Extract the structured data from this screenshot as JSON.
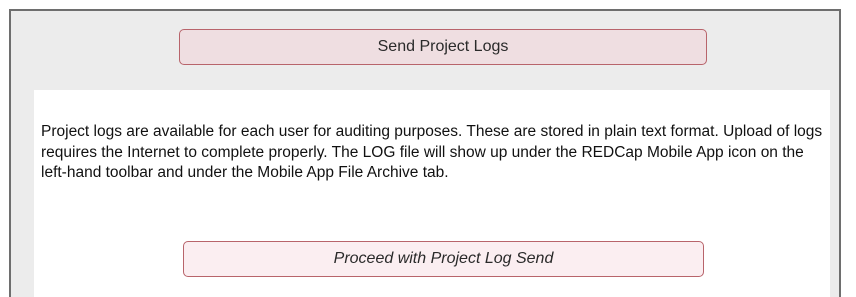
{
  "header": {
    "send_button_label": "Send Project Logs"
  },
  "panel": {
    "description": "Project logs are available for each user for auditing purposes. These are stored in plain text format. Upload of logs requires the Internet to complete properly. The LOG file will show up under the REDCap Mobile App icon on the left-hand toolbar and under the Mobile App File Archive tab.",
    "proceed_button_label": "Proceed with Project Log Send"
  },
  "colors": {
    "button_border": "#b8646b",
    "button_fill": "#efdee1",
    "panel_background": "#ffffff",
    "frame_background": "#ececec"
  }
}
